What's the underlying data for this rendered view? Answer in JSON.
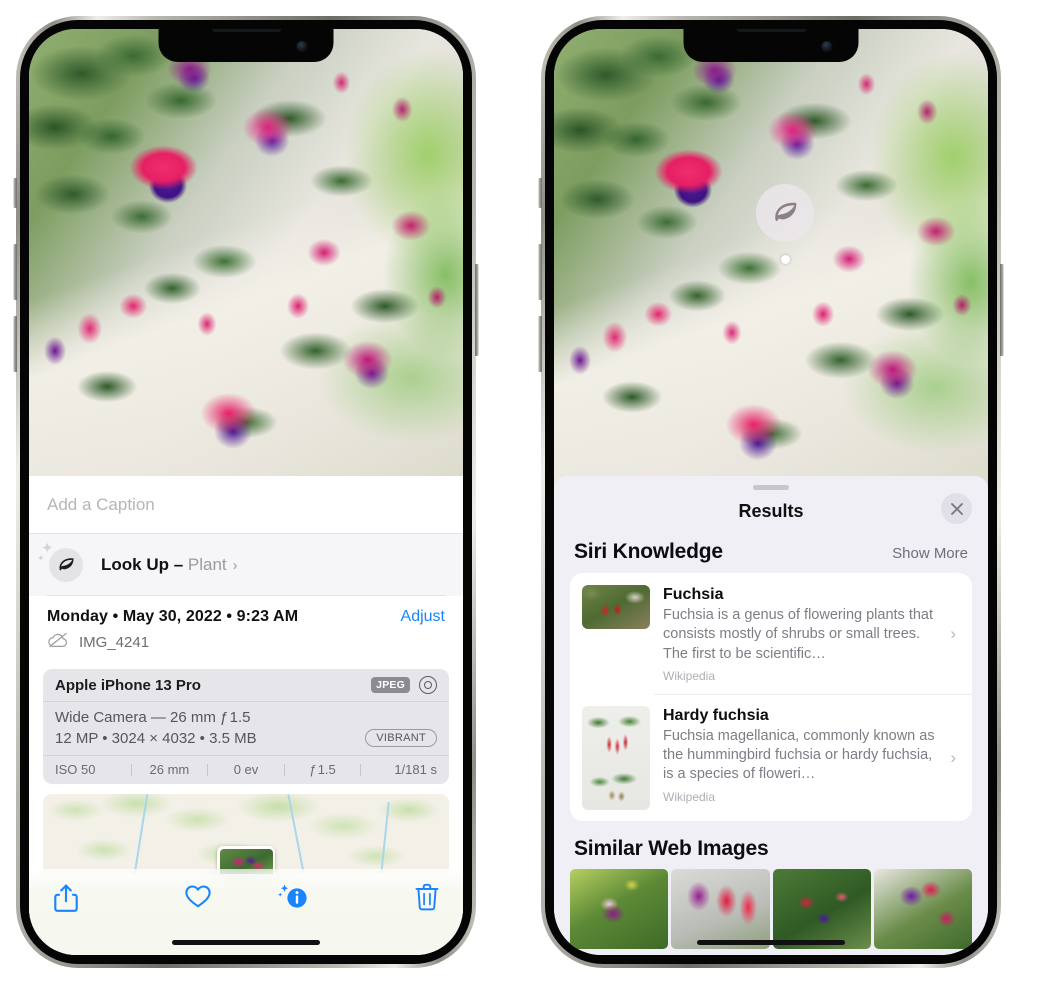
{
  "left_phone": {
    "photo": {
      "alt": "fuchsia-flowers-photo"
    },
    "caption": {
      "placeholder": "Add a Caption",
      "value": ""
    },
    "lookup": {
      "icon": "leaf-icon",
      "sparkle_icon": "sparkle-icon",
      "label": "Look Up – ",
      "kind": "Plant",
      "chevron": "›"
    },
    "metadata": {
      "date": "Monday • May 30, 2022 • 9:23 AM",
      "adjust_label": "Adjust",
      "cloud_icon": "cloud-slash-icon",
      "filename": "IMG_4241"
    },
    "camera": {
      "model": "Apple iPhone 13 Pro",
      "format_tag": "JPEG",
      "lens_icon": "aperture-icon",
      "lens_line": "Wide Camera — 26 mm ƒ 1.5",
      "size_line": "12 MP • 3024 × 4032 • 3.5 MB",
      "style_tag": "VIBRANT",
      "exif": [
        "ISO 50",
        "26 mm",
        "0 ev",
        "ƒ 1.5",
        "1/181 s"
      ]
    },
    "map": {
      "pin": "photo-thumbnail-pin"
    },
    "toolbar": [
      {
        "name": "share-icon",
        "label": "Share"
      },
      {
        "name": "heart-icon",
        "label": "Favorite"
      },
      {
        "name": "info-sparkle-icon",
        "label": "Info"
      },
      {
        "name": "trash-icon",
        "label": "Delete"
      }
    ]
  },
  "right_phone": {
    "photo": {
      "alt": "fuchsia-flowers-photo"
    },
    "badge": {
      "icon": "leaf-icon",
      "dot": "subject-indicator-dot"
    },
    "sheet": {
      "grabber": "sheet-grabber",
      "title": "Results",
      "close_icon": "✕"
    },
    "siri_knowledge": {
      "title": "Siri Knowledge",
      "show_more": "Show More",
      "items": [
        {
          "thumb": "fuchsia-thumbnail",
          "title": "Fuchsia",
          "desc": "Fuchsia is a genus of flowering plants that consists mostly of shrubs or small trees. The first to be scientific…",
          "source": "Wikipedia",
          "chevron": "›"
        },
        {
          "thumb": "hardy-fuchsia-thumbnail",
          "title": "Hardy fuchsia",
          "desc": "Fuchsia magellanica, commonly known as the hummingbird fuchsia or hardy fuchsia, is a species of floweri…",
          "source": "Wikipedia",
          "chevron": "›"
        }
      ]
    },
    "similar_web_images": {
      "title": "Similar Web Images",
      "items": [
        {
          "name": "web-image-1"
        },
        {
          "name": "web-image-2"
        },
        {
          "name": "web-image-3"
        },
        {
          "name": "web-image-4"
        }
      ]
    }
  },
  "colors": {
    "accent_blue": "#1a84ff",
    "sheet_bg": "#f0eff5",
    "card_bg": "#ffffff",
    "camera_card_bg": "#e6e6ea",
    "secondary_text": "#7d7d86"
  }
}
